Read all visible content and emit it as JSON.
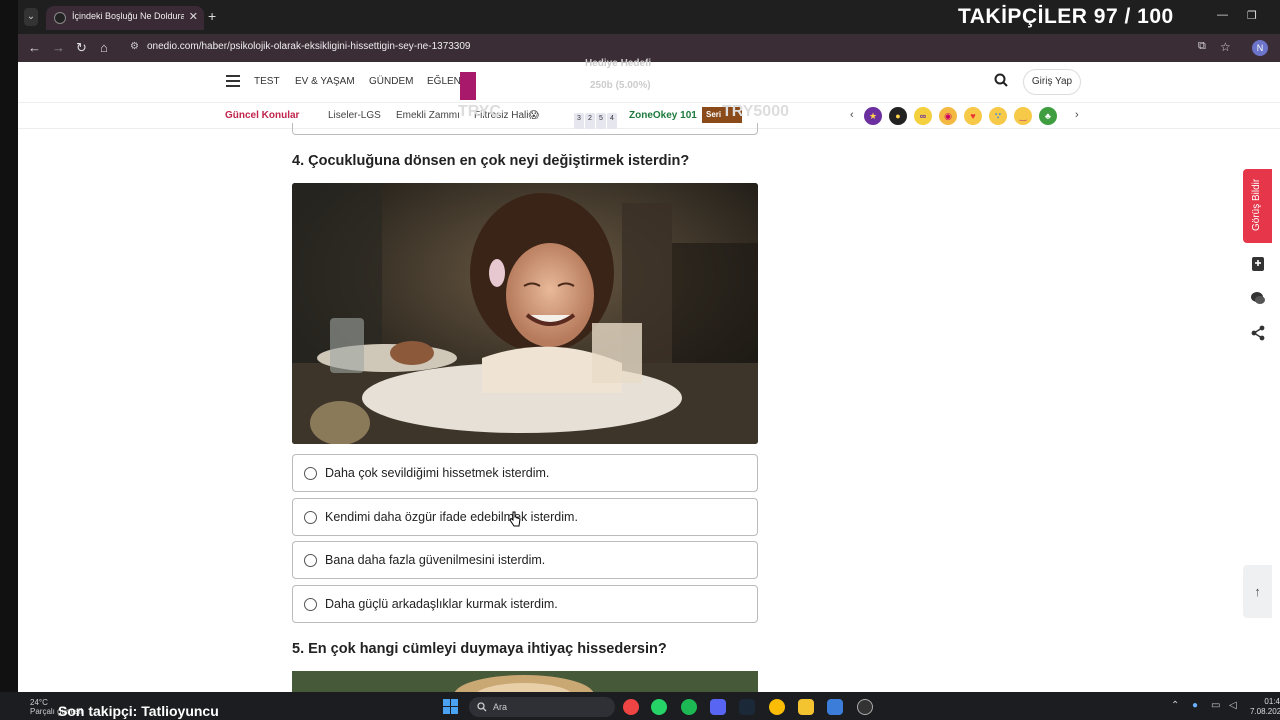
{
  "browser": {
    "tab_title": "İçindeki Boşluğu Ne Doldurabilir",
    "url": "onedio.com/haber/psikolojik-olarak-eksikligini-hissettigin-sey-ne-1373309",
    "avatar_letter": "N"
  },
  "overlay": {
    "followers_label": "TAKİPÇİLER 97 / 100",
    "faint_1": "Hediye Hedefi",
    "faint_2": "250b (5.00%)",
    "faint_3": "TRYC",
    "faint_4": "TRY5000"
  },
  "header": {
    "nav": [
      "TEST",
      "EV & YAŞAM",
      "GÜNDEM",
      "EĞLEN"
    ],
    "login": "Giriş Yap"
  },
  "topics": {
    "label": "Güncel Konular",
    "items": [
      "Liseler-LGS",
      "Emekli Zammı",
      "Filtresiz Hali😱"
    ],
    "lotto": [
      "3",
      "2",
      "5",
      "4"
    ],
    "zone": "ZoneOkey 101",
    "seri": "Seri"
  },
  "content": {
    "q4_title": "4. Çocukluğuna dönsen en çok neyi değiştirmek isterdin?",
    "q4_options": [
      "Daha çok sevildiğimi hissetmek isterdim.",
      "Kendimi daha özgür ifade edebilmek isterdim.",
      "Bana daha fazla güvenilmesini isterdim.",
      "Daha güçlü arkadaşlıklar kurmak isterdim."
    ],
    "q5_title": "5. En çok hangi cümleyi duymaya ihtiyaç hissedersin?"
  },
  "side": {
    "feedback": "Görüş Bildir"
  },
  "taskbar": {
    "follower": "Son takipçi: Tatlioyuncu",
    "temp": "24°C",
    "weather": "Parçalı güneşli",
    "search": "Ara",
    "time": "01:4",
    "date": "7.08.202"
  },
  "colors": {
    "brand_red": "#c0244c",
    "feedback_red": "#e5364a",
    "nav_magenta": "#a8196b"
  }
}
